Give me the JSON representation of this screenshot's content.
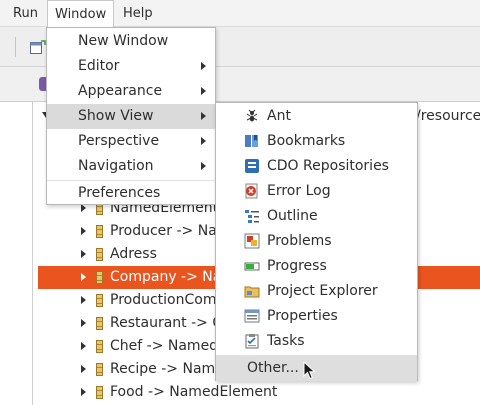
{
  "menubar": {
    "items": [
      {
        "label": "Run"
      },
      {
        "label": "Window"
      },
      {
        "label": "Help"
      }
    ]
  },
  "editor": {
    "path_fragment": "/resource"
  },
  "tree": {
    "rows": [
      {
        "label": "NamedElement"
      },
      {
        "label": "Producer -> NamedElement"
      },
      {
        "label": "Adress"
      },
      {
        "label": "Company -> NamedElement",
        "selected": true
      },
      {
        "label": "ProductionCompany"
      },
      {
        "label": "Restaurant -> Company"
      },
      {
        "label": "Chef -> NamedElement"
      },
      {
        "label": "Recipe -> NamedElement"
      },
      {
        "label": "Food -> NamedElement"
      }
    ]
  },
  "window_menu": {
    "items": [
      {
        "label": "New Window",
        "submenu": false
      },
      {
        "label": "Editor",
        "submenu": true
      },
      {
        "label": "Appearance",
        "submenu": true
      },
      {
        "label": "Show View",
        "submenu": true,
        "highlighted": true
      },
      {
        "label": "Perspective",
        "submenu": true
      },
      {
        "label": "Navigation",
        "submenu": true
      },
      {
        "label": "Preferences",
        "submenu": false
      }
    ]
  },
  "show_view_menu": {
    "items": [
      {
        "label": "Ant",
        "icon": "ant-icon"
      },
      {
        "label": "Bookmarks",
        "icon": "bookmarks-icon"
      },
      {
        "label": "CDO Repositories",
        "icon": "cdo-repositories-icon"
      },
      {
        "label": "Error Log",
        "icon": "error-log-icon"
      },
      {
        "label": "Outline",
        "icon": "outline-icon"
      },
      {
        "label": "Problems",
        "icon": "problems-icon"
      },
      {
        "label": "Progress",
        "icon": "progress-icon"
      },
      {
        "label": "Project Explorer",
        "icon": "project-explorer-icon"
      },
      {
        "label": "Properties",
        "icon": "properties-icon"
      },
      {
        "label": "Tasks",
        "icon": "tasks-icon"
      },
      {
        "label": "Other...",
        "highlighted": true
      }
    ]
  },
  "colors": {
    "selection": "#e9541f",
    "menu_hover": "#dadada"
  }
}
